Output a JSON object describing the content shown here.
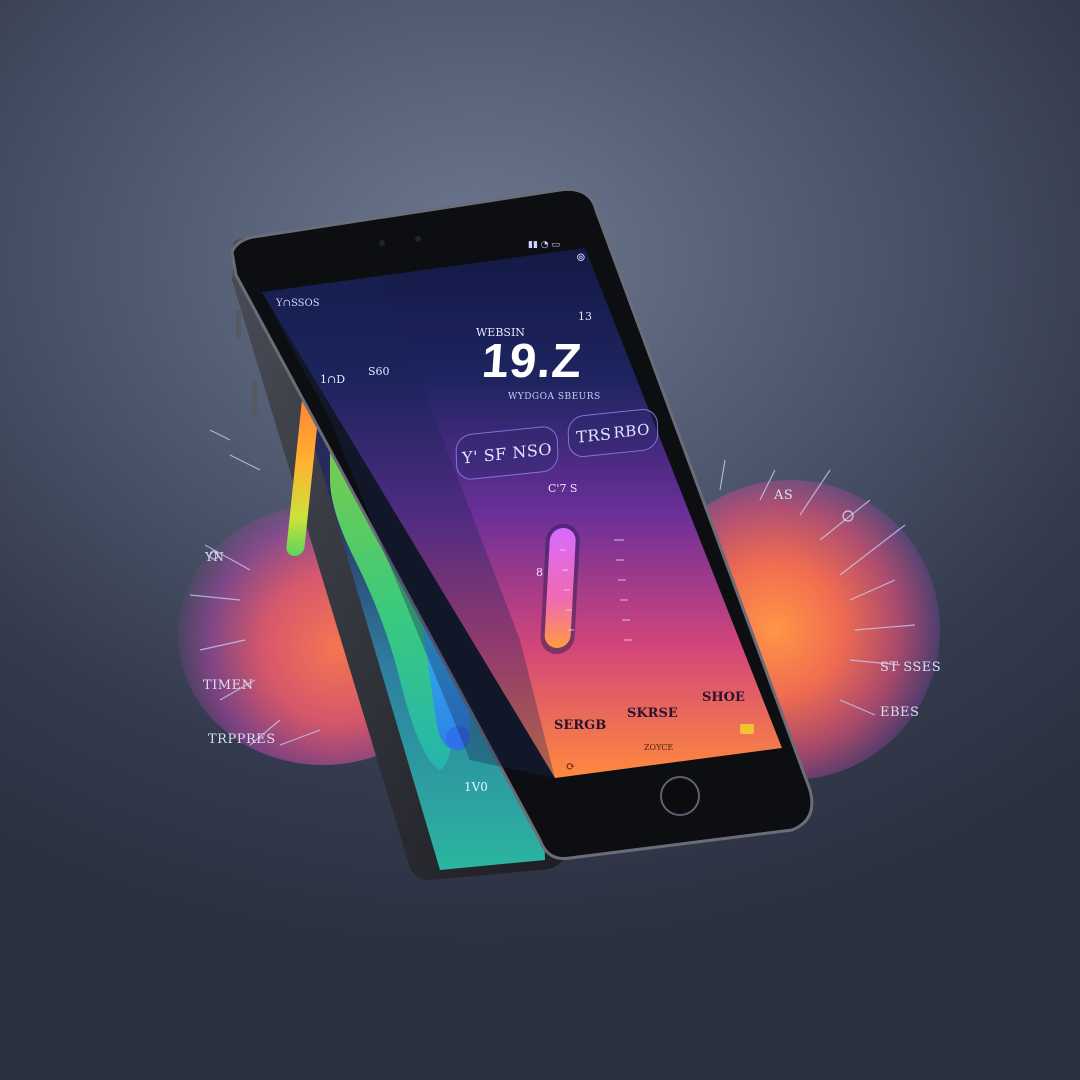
{
  "scene": {
    "background_colors": [
      "#6d7890",
      "#343a4d"
    ],
    "accent_colors": [
      "#ff7a45",
      "#f05a6e",
      "#b046aa",
      "#3ecf8e",
      "#2fb7e8",
      "#f2c230"
    ]
  },
  "left_screen": {
    "header_label": "Y∩SSOS",
    "scale_left": "1∩D",
    "scale_right": "S60",
    "bottom_label": "1V0"
  },
  "right_screen": {
    "top_left_label": "WEBSIN",
    "top_right_label": "13",
    "main_value": "19.Z",
    "subtitle": "WYDGOA SBEURS",
    "pill_left_label": "Y' SF NSO",
    "pill_right_label": "TRS",
    "pill_right_badge": "RBO",
    "gauge_label": "C'7 S",
    "gauge_side_label": "8",
    "bottom_labels": [
      "SERGB",
      "SKRSE",
      "SHOE"
    ],
    "footer_badge": "ZOYCE"
  },
  "ambient_labels": {
    "left": [
      "YN",
      "TIMEN",
      "TRPPRES"
    ],
    "right": [
      "AS",
      "ST SSES",
      "EBES"
    ]
  },
  "icons": {
    "status_bar": [
      "signal-icon",
      "wifi-icon",
      "battery-icon"
    ],
    "screen_top": "alarm-icon",
    "footer_left": "sync-icon",
    "footer_right": "card-icon"
  }
}
